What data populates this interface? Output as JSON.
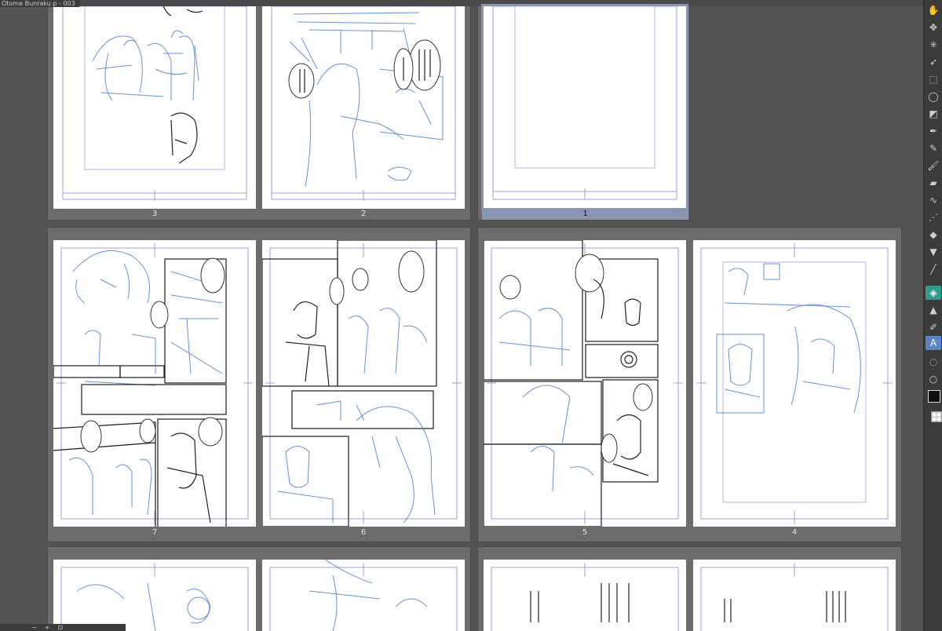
{
  "window": {
    "title": "Otome Bunraku p - 003"
  },
  "pages": {
    "p1": {
      "label": "1",
      "selected": true
    },
    "p2": {
      "label": "2"
    },
    "p3": {
      "label": "3"
    },
    "p4": {
      "label": "4"
    },
    "p5": {
      "label": "5"
    },
    "p6": {
      "label": "6"
    },
    "p7": {
      "label": "7"
    }
  },
  "toolbar": {
    "tools": [
      "hand-icon",
      "move-icon",
      "magic-wand-icon",
      "lasso-icon",
      "selection-icon",
      "eyedropper-icon",
      "ruler-icon",
      "pen-icon",
      "pencil-icon",
      "brush-icon",
      "eraser-icon",
      "blend-icon",
      "airbrush-icon",
      "fill-icon",
      "gradient-icon",
      "figure-icon",
      "frame-icon",
      "operation-icon",
      "text-icon",
      "balloon-icon",
      "correction-icon"
    ],
    "main_color": "#111111",
    "sub_color": "transparent"
  },
  "bottom": {
    "minus": "−",
    "plus": "+"
  },
  "colors": {
    "background": "#545454",
    "group_bg": "#6c6c6c",
    "selection": "#8a95b1",
    "sketch_blue": "#4a7fd0",
    "frame_guide": "#9aa0d8"
  }
}
